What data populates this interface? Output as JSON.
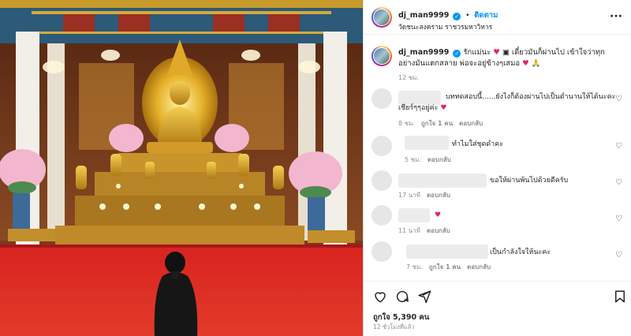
{
  "post": {
    "username": "dj_man9999",
    "follow_label": "ติดตาม",
    "location": "วัดชนะสงคราม ราชวรมหาวิหาร",
    "caption_start": "รักแม่นะ",
    "caption_mid": "เดี๋ยวมันก็ผ่านไป เข้าใจว่าทุกอย่างมันแตกสลาย พ่อจะอยู่ข้างๆเสมอ",
    "caption_time": "12 ชม.",
    "likes": "ถูกใจ 5,390 คน",
    "time_ago": "12 ชั่วโมงที่แล้ว"
  },
  "comments": [
    {
      "text_line1": "บททดสอบนี้......ยังไงก็ต้องผ่านไปเป็นตำนานให้ได้นะคะ",
      "text_line2": "เชียร์ๆๆอยู่ค่ะ",
      "time": "8 ชม.",
      "likes": "ถูกใจ 1 คน",
      "reply": "ตอบกลับ"
    },
    {
      "text": "ทำไมใส่ชุดดำคะ",
      "time": "5 ชม.",
      "reply": "ตอบกลับ"
    },
    {
      "text": "ขอให้ผ่านพ้นไปด้วยดีครับ",
      "time": "17 นาที",
      "reply": "ตอบกลับ"
    },
    {
      "text": "",
      "time": "11 นาที",
      "reply": "ตอบกลับ"
    },
    {
      "text": "เป็นกำลังใจให้นะคะ",
      "time": "7 ชม.",
      "likes": "ถูกใจ 1 คน",
      "reply": "ตอบกลับ"
    }
  ],
  "icons": {
    "verified": "verified-badge-icon",
    "more": "more-options-icon",
    "like": "heart-icon",
    "comment": "comment-icon",
    "share": "share-icon",
    "save": "bookmark-icon"
  },
  "colors": {
    "accent": "#0095f6",
    "heart": "#e0245e",
    "meta": "#8e8e8e"
  }
}
